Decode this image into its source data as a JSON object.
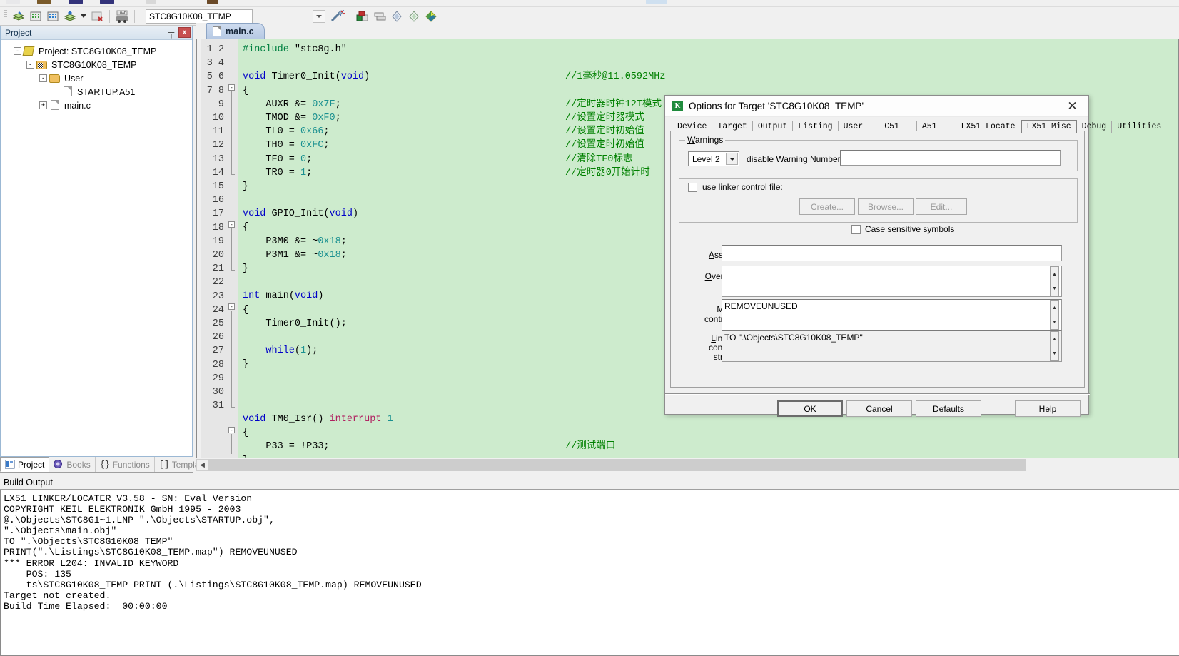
{
  "toolbar": {
    "project_name": "STC8G10K08_TEMP",
    "icons": [
      "build-icon",
      "rebuild-icon",
      "batch-build-icon",
      "translate-icon",
      "stop-build-icon",
      "download-icon",
      "target-options-icon",
      "manage-components-icon",
      "books-icon",
      "start-debug-icon",
      "insert-bookmark-icon",
      "prev-bookmark-icon",
      "next-bookmark-icon"
    ]
  },
  "project_panel": {
    "title": "Project",
    "pin_glyph": "╤",
    "close_glyph": "x",
    "tree": [
      {
        "label": "Project: STC8G10K08_TEMP",
        "icon": "project-icon",
        "toggle": "-",
        "indent": 0
      },
      {
        "label": "STC8G10K08_TEMP",
        "icon": "target-icon",
        "toggle": "-",
        "indent": 1
      },
      {
        "label": "User",
        "icon": "folder-icon",
        "toggle": "-",
        "indent": 2
      },
      {
        "label": "STARTUP.A51",
        "icon": "file-icon",
        "toggle": "",
        "indent": 3
      },
      {
        "label": "main.c",
        "icon": "file-icon",
        "toggle": "+",
        "indent": 3
      }
    ],
    "tabs": [
      {
        "label": "Project",
        "icon": "project-tab-icon",
        "active": true
      },
      {
        "label": "Books",
        "icon": "books-tab-icon",
        "active": false
      },
      {
        "label": "Functions",
        "icon": "functions-tab-icon",
        "active": false
      },
      {
        "label": "Templates",
        "icon": "templates-tab-icon",
        "active": false
      }
    ]
  },
  "editor": {
    "tab_label": "main.c",
    "line_numbers": [
      "1",
      "2",
      "3",
      "4",
      "5",
      "6",
      "7",
      "8",
      "9",
      "10",
      "11",
      "12",
      "13",
      "14",
      "15",
      "16",
      "17",
      "18",
      "19",
      "20",
      "21",
      "22",
      "23",
      "24",
      "25",
      "26",
      "27",
      "28",
      "29",
      "30",
      "31"
    ],
    "code_lines": [
      {
        "n": 1,
        "code": "#include \"stc8g.h\"",
        "comment": ""
      },
      {
        "n": 2,
        "code": "",
        "comment": ""
      },
      {
        "n": 3,
        "code": "void Timer0_Init(void)",
        "comment": "//1毫秒@11.0592MHz"
      },
      {
        "n": 4,
        "code": "{",
        "comment": ""
      },
      {
        "n": 5,
        "code": "    AUXR &= 0x7F;",
        "comment": "//定时器时钟12T模式"
      },
      {
        "n": 6,
        "code": "    TMOD &= 0xF0;",
        "comment": "//设置定时器模式"
      },
      {
        "n": 7,
        "code": "    TL0 = 0x66;",
        "comment": "//设置定时初始值"
      },
      {
        "n": 8,
        "code": "    TH0 = 0xFC;",
        "comment": "//设置定时初始值"
      },
      {
        "n": 9,
        "code": "    TF0 = 0;",
        "comment": "//清除TF0标志"
      },
      {
        "n": 10,
        "code": "    TR0 = 1;",
        "comment": "//定时器0开始计时"
      },
      {
        "n": 11,
        "code": "}",
        "comment": ""
      },
      {
        "n": 12,
        "code": "",
        "comment": ""
      },
      {
        "n": 13,
        "code": "void GPIO_Init(void)",
        "comment": ""
      },
      {
        "n": 14,
        "code": "{",
        "comment": ""
      },
      {
        "n": 15,
        "code": "    P3M0 &= ~0x18;",
        "comment": ""
      },
      {
        "n": 16,
        "code": "    P3M1 &= ~0x18;",
        "comment": ""
      },
      {
        "n": 17,
        "code": "}",
        "comment": ""
      },
      {
        "n": 18,
        "code": "",
        "comment": ""
      },
      {
        "n": 19,
        "code": "int main(void)",
        "comment": ""
      },
      {
        "n": 20,
        "code": "{",
        "comment": ""
      },
      {
        "n": 21,
        "code": "    Timer0_Init();",
        "comment": ""
      },
      {
        "n": 22,
        "code": "",
        "comment": ""
      },
      {
        "n": 23,
        "code": "    while(1);",
        "comment": ""
      },
      {
        "n": 24,
        "code": "}",
        "comment": ""
      },
      {
        "n": 25,
        "code": "",
        "comment": ""
      },
      {
        "n": 26,
        "code": "",
        "comment": ""
      },
      {
        "n": 27,
        "code": "",
        "comment": ""
      },
      {
        "n": 28,
        "code": "void TM0_Isr() interrupt 1",
        "comment": ""
      },
      {
        "n": 29,
        "code": "{",
        "comment": ""
      },
      {
        "n": 30,
        "code": "    P33 = !P33;",
        "comment": "//测试端口"
      },
      {
        "n": 31,
        "code": "}",
        "comment": ""
      }
    ]
  },
  "build_output": {
    "title": "Build Output",
    "text": "LX51 LINKER/LOCATER V3.58 - SN: Eval Version\nCOPYRIGHT KEIL ELEKTRONIK GmbH 1995 - 2003\n@.\\Objects\\STC8G1~1.LNP \".\\Objects\\STARTUP.obj\",\n\".\\Objects\\main.obj\"\nTO \".\\Objects\\STC8G10K08_TEMP\"\nPRINT(\".\\Listings\\STC8G10K08_TEMP.map\") REMOVEUNUSED\n*** ERROR L204: INVALID KEYWORD\n    POS: 135\n    ts\\STC8G10K08_TEMP PRINT (.\\Listings\\STC8G10K08_TEMP.map) REMOVEUNUSED\nTarget not created.\nBuild Time Elapsed:  00:00:00"
  },
  "dialog": {
    "title": "Options for Target 'STC8G10K08_TEMP'",
    "logo_text": "K",
    "close_glyph": "✕",
    "tabs": [
      {
        "label": "Device",
        "active": false
      },
      {
        "label": "Target",
        "active": false
      },
      {
        "label": "Output",
        "active": false
      },
      {
        "label": "Listing",
        "active": false
      },
      {
        "label": "User",
        "active": false
      },
      {
        "label": "C51",
        "active": false
      },
      {
        "label": "A51",
        "active": false
      },
      {
        "label": "LX51 Locate",
        "active": false
      },
      {
        "label": "LX51 Misc",
        "active": true
      },
      {
        "label": "Debug",
        "active": false
      },
      {
        "label": "Utilities",
        "active": false
      }
    ],
    "warnings": {
      "group_label": "Warnings",
      "level_value": "Level 2",
      "disable_label": "disable Warning Numbers:",
      "disable_value": ""
    },
    "linker_control_file": {
      "checkbox_label": "use linker control file:",
      "checked": false,
      "create_label": "Create...",
      "browse_label": "Browse...",
      "edit_label": "Edit..."
    },
    "case_sensitive": {
      "label": "Case sensitive symbols",
      "checked": false
    },
    "fields": {
      "assign_label": "Assign",
      "assign_value": "",
      "overlay_label": "Overlay",
      "overlay_value": "",
      "misc_label_line1": "Misc",
      "misc_label_line2": "controls",
      "misc_value": "REMOVEUNUSED",
      "linker_label_line1": "Linker",
      "linker_label_line2": "control",
      "linker_label_line3": "string",
      "linker_value": "TO \".\\Objects\\STC8G10K08_TEMP\""
    },
    "buttons": {
      "ok": "OK",
      "cancel": "Cancel",
      "defaults": "Defaults",
      "help": "Help"
    }
  },
  "colors": {
    "editor_background": "#cdebcd",
    "comment_green": "#008000",
    "keyword_blue": "#0000c8",
    "number_teal": "#1a9090",
    "interrupt_pink": "#b02060",
    "dialog_face": "#f0f0f0"
  }
}
